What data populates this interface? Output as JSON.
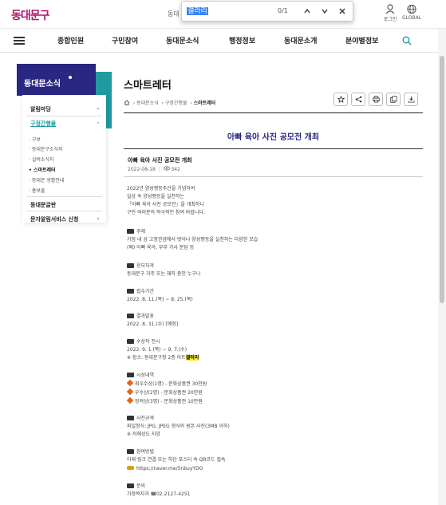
{
  "header": {
    "logo": "동대문구",
    "top_text_clip": "동대",
    "login_label": "로그인",
    "global_label": "GLOBAL"
  },
  "find_bar": {
    "query": "갤러리",
    "count": "0/1",
    "prev_icon": "chevron-up-icon",
    "next_icon": "chevron-down-icon",
    "close_icon": "close-icon"
  },
  "nav": {
    "items": [
      "종합민원",
      "구민참여",
      "동대문소식",
      "행정정보",
      "동대문소개",
      "분야별정보"
    ]
  },
  "sidebar": {
    "title": "동대문소식",
    "items": [
      {
        "label": "알림마당",
        "chevron": "⌄"
      },
      {
        "label": "구정간행물",
        "chevron": "⌃"
      }
    ],
    "sub_items": [
      "구보",
      "동대문구소식지",
      "실버소식지",
      "스마트레터",
      "동대문 생활안내",
      "홍보물"
    ],
    "bottom_items": [
      "동대문글판",
      "문자알림서비스 신청"
    ]
  },
  "page": {
    "title": "스마트레터",
    "breadcrumb": [
      "동대문소식",
      "구정간행물",
      "스마트레터"
    ]
  },
  "article": {
    "title": "아빠 육아 사진 공모전 개최",
    "post_title": "아빠 육아 사진 공모전 개최",
    "date": "2022-08-18",
    "views": "342",
    "intro": [
      "2022년 양성평등주간을 기념하여",
      "일상 속 양성평등을 실천하는",
      "「아빠 육아 사진 공모전」을 개최하니",
      "구민 여러분의 적극적인 참여 바랍니다."
    ],
    "sections": [
      {
        "heading": "주제",
        "lines": [
          "가정 내 성 고정관념에서 벗어나 양성평등을 실천하는 다양한 모습",
          "(예) 아빠 육아, 부부 가사 분담 등"
        ]
      },
      {
        "heading": "응모자격",
        "lines": [
          "동대문구 거주 또는 재직 중인 누구나"
        ]
      },
      {
        "heading": "접수기간",
        "lines": [
          "2022. 8. 11.(목) ~ 8. 25.(목)"
        ]
      },
      {
        "heading": "결과발표",
        "lines": [
          "2022. 8. 31.(수) [예정]"
        ]
      },
      {
        "heading": "수상작 전시",
        "lines": [
          "2022. 9. 1.(목) ~ 9. 7.(수)"
        ]
      },
      {
        "heading": "시상내역",
        "lines": [
          "최우수상(1명) - 문화상품권 30만원",
          "우수상(2명) - 문화상품권 20만원",
          "장려상(3명) - 문화상품권 10만원"
        ]
      },
      {
        "heading": "사진규격",
        "lines": [
          "파일형식: JPG, JPEG 형식의 원본 사진(3MB 이하)",
          "※ 저해상도 지양"
        ]
      },
      {
        "heading": "참여방법",
        "lines": [
          "아래 링크 연결 또는 하단 포스터 속 QR코드 접속",
          "https://naver.me/5nbuyYDO"
        ]
      },
      {
        "heading": "문의",
        "lines": [
          "가정복지과 ☎02-2127-4251"
        ]
      }
    ],
    "venue_prefix": "※ 장소: 동대문구청 2층 아트",
    "venue_highlight": "갤러리"
  },
  "colors": {
    "brand_magenta": "#b0186b",
    "sidebar_navy": "#2a2782",
    "sidebar_teal": "#1f9aa0",
    "find_highlight": "#ffe629"
  }
}
